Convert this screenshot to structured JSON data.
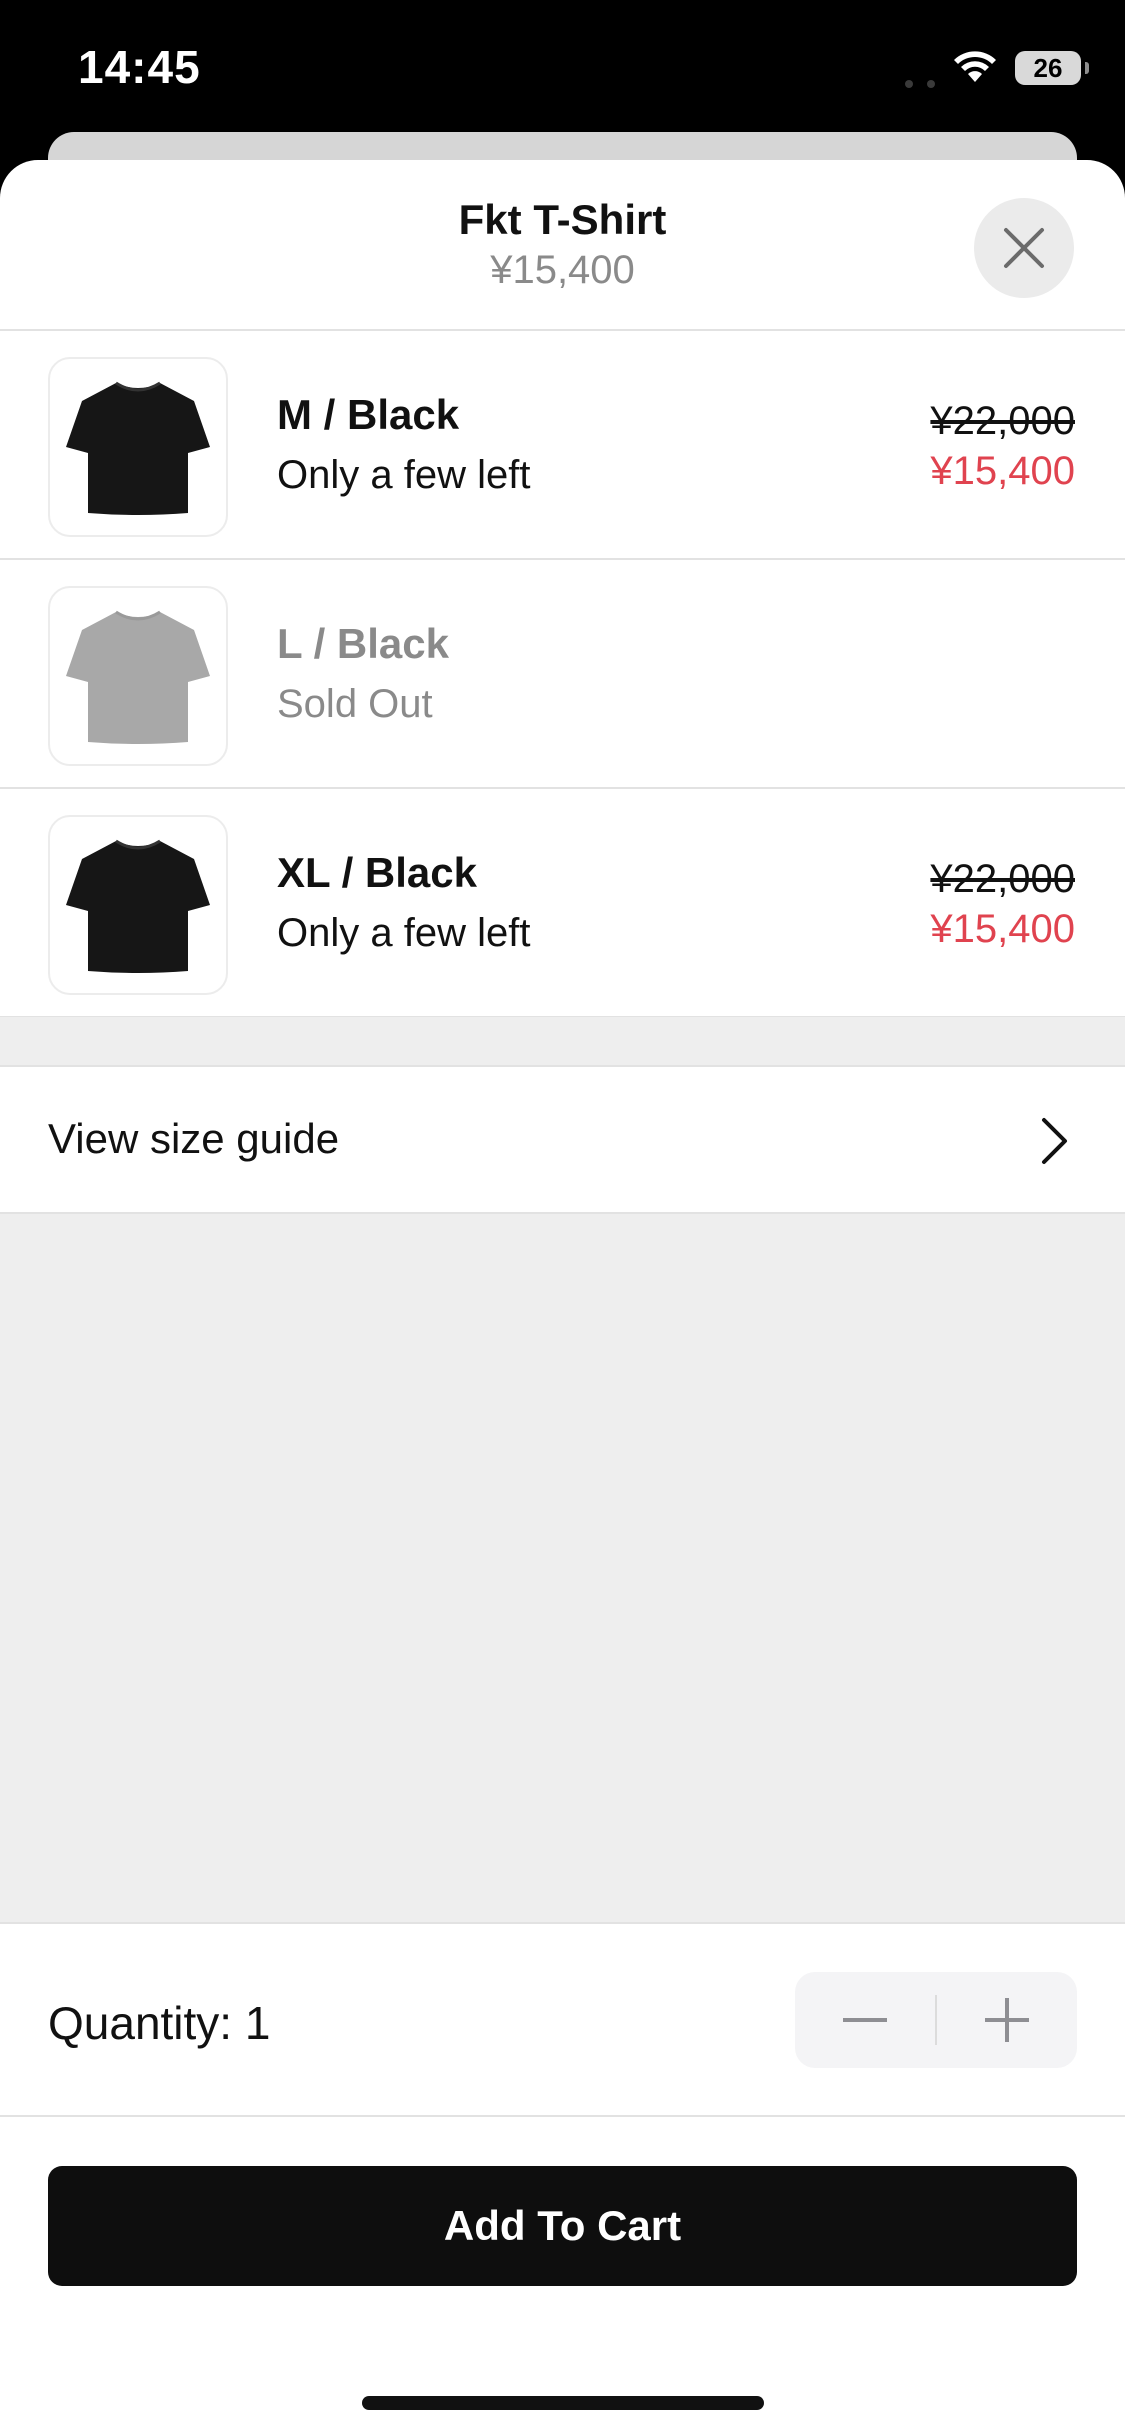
{
  "status_bar": {
    "time": "14:45",
    "battery": "26",
    "wifi_icon": "wifi-icon",
    "signal_icon": "cellular-signal-icon"
  },
  "sheet": {
    "title": "Fkt T-Shirt",
    "price": "¥15,400",
    "close_icon": "close-icon"
  },
  "variants": [
    {
      "name": "M / Black",
      "stock": "Only a few left",
      "original_price": "¥22,000",
      "sale_price": "¥15,400",
      "available": true,
      "thumbnail": "black-tshirt-image"
    },
    {
      "name": "L / Black",
      "stock": "Sold Out",
      "original_price": "",
      "sale_price": "",
      "available": false,
      "thumbnail": "grey-tshirt-image"
    },
    {
      "name": "XL / Black",
      "stock": "Only a few left",
      "original_price": "¥22,000",
      "sale_price": "¥15,400",
      "available": true,
      "thumbnail": "black-tshirt-image"
    }
  ],
  "size_guide": {
    "label": "View size guide",
    "icon": "chevron-right-icon"
  },
  "quantity": {
    "label": "Quantity: ",
    "value": "1",
    "decrement_icon": "minus-icon",
    "increment_icon": "plus-icon"
  },
  "cta": {
    "label": "Add To Cart"
  },
  "colors": {
    "sale_price": "#e0434f",
    "button_bg": "#0e0e0e",
    "muted_text": "#8a8a8a"
  }
}
